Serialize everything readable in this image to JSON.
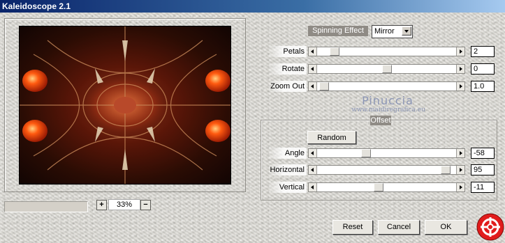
{
  "window": {
    "title": "Kaleidoscope 2.1"
  },
  "preview": {
    "zoom": "33%",
    "zoom_in": "+",
    "zoom_out": "−"
  },
  "spinning_effect": {
    "label": "Spinning Effect",
    "selected": "Mirror"
  },
  "sliders": {
    "petals": {
      "label": "Petals",
      "value": "2",
      "position": 0.1
    },
    "rotate": {
      "label": "Rotate",
      "value": "0",
      "position": 0.5
    },
    "zoom_out": {
      "label": "Zoom Out",
      "value": "1.0",
      "position": 0.02
    }
  },
  "offset": {
    "label": "Offset",
    "random_button": "Random",
    "angle": {
      "label": "Angle",
      "value": "-58",
      "position": 0.34
    },
    "horizontal": {
      "label": "Horizontal",
      "value": "95",
      "position": 0.95
    },
    "vertical": {
      "label": "Vertical",
      "value": "-11",
      "position": 0.44
    }
  },
  "watermark": {
    "name": "Pinuccia",
    "url": "www.maidiregrafica.eu"
  },
  "buttons": {
    "reset": "Reset",
    "cancel": "Cancel",
    "ok": "OK"
  },
  "icons": {
    "logo": "filter-unlimited-logo-icon",
    "accent": "#e11c1c"
  }
}
